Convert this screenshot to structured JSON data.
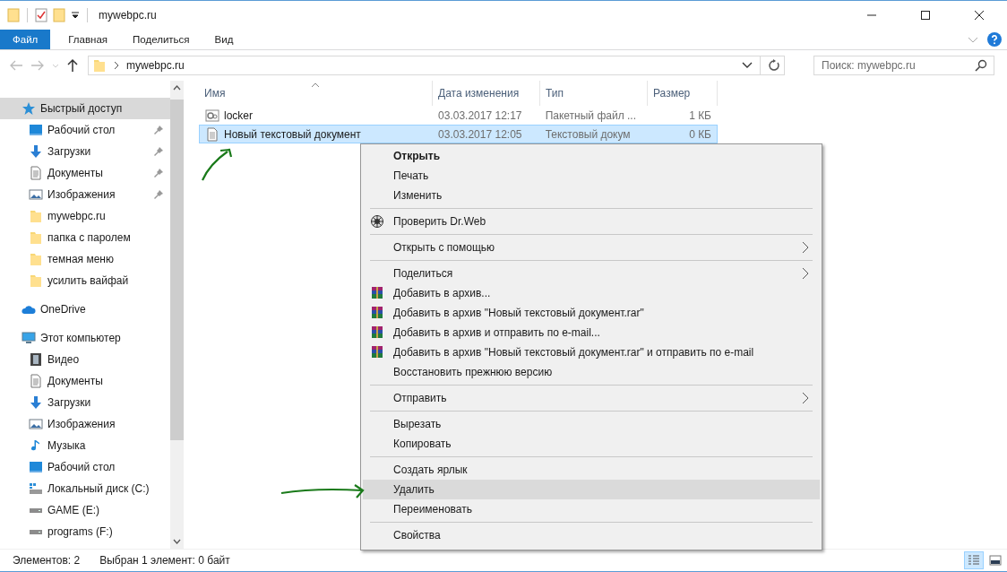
{
  "window": {
    "title": "mywebpc.ru"
  },
  "ribbon": {
    "tabs": [
      {
        "label": "Файл",
        "kind": "file"
      },
      {
        "label": "Главная",
        "kind": "tab"
      },
      {
        "label": "Поделиться",
        "kind": "tab"
      },
      {
        "label": "Вид",
        "kind": "tab"
      }
    ]
  },
  "address": {
    "path": "mywebpc.ru"
  },
  "search": {
    "placeholder": "Поиск: mywebpc.ru"
  },
  "sidebar": {
    "items": [
      {
        "label": "Быстрый доступ",
        "kind": "star",
        "selected": true,
        "children": [
          {
            "label": "Рабочий стол",
            "kind": "desktop",
            "pinned": true,
            "selected": false
          },
          {
            "label": "Загрузки",
            "kind": "download",
            "pinned": true,
            "selected": false
          },
          {
            "label": "Документы",
            "kind": "document",
            "pinned": true,
            "selected": false
          },
          {
            "label": "Изображения",
            "kind": "pictures",
            "pinned": true,
            "selected": false
          },
          {
            "label": "mywebpc.ru",
            "kind": "folder",
            "pinned": false,
            "selected": false
          },
          {
            "label": "папка с паролем",
            "kind": "folder",
            "pinned": false,
            "selected": false
          },
          {
            "label": "темная меню",
            "kind": "folder",
            "pinned": false,
            "selected": false
          },
          {
            "label": "усилить вайфай",
            "kind": "folder",
            "pinned": false,
            "selected": false
          }
        ]
      },
      {
        "label": "OneDrive",
        "kind": "cloud",
        "selected": false
      },
      {
        "label": "Этот компьютер",
        "kind": "computer",
        "selected": false,
        "children": [
          {
            "label": "Видео",
            "kind": "video",
            "pinned": false,
            "selected": false
          },
          {
            "label": "Документы",
            "kind": "document",
            "pinned": false,
            "selected": false
          },
          {
            "label": "Загрузки",
            "kind": "download",
            "pinned": false,
            "selected": false
          },
          {
            "label": "Изображения",
            "kind": "pictures",
            "pinned": false,
            "selected": false
          },
          {
            "label": "Музыка",
            "kind": "music",
            "pinned": false,
            "selected": false
          },
          {
            "label": "Рабочий стол",
            "kind": "desktop",
            "pinned": false,
            "selected": false
          },
          {
            "label": "Локальный диск (C:)",
            "kind": "drive_os",
            "pinned": false,
            "selected": false
          },
          {
            "label": "GAME (E:)",
            "kind": "drive",
            "pinned": false,
            "selected": false
          },
          {
            "label": "programs (F:)",
            "kind": "drive",
            "pinned": false,
            "selected": false
          }
        ]
      }
    ]
  },
  "table": {
    "columns": [
      "Имя",
      "Дата изменения",
      "Тип",
      "Размер"
    ],
    "rows": [
      {
        "name": "locker",
        "kind": "batch",
        "date": "03.03.2017 12:17",
        "type": "Пакетный файл ...",
        "size": "1 КБ",
        "selected": false
      },
      {
        "name": "Новый текстовый документ",
        "kind": "text",
        "date": "03.03.2017 12:05",
        "type": "Текстовый докум",
        "size": "0 КБ",
        "selected": true
      }
    ]
  },
  "context_menu": {
    "groups": [
      [
        {
          "label": "Открыть",
          "kind": "plain",
          "default": true,
          "submenu": false,
          "selected": false
        },
        {
          "label": "Печать",
          "kind": "plain",
          "default": false,
          "submenu": false,
          "selected": false
        },
        {
          "label": "Изменить",
          "kind": "plain",
          "default": false,
          "submenu": false,
          "selected": false
        }
      ],
      [
        {
          "label": "Проверить Dr.Web",
          "kind": "drweb",
          "default": false,
          "submenu": false,
          "selected": false
        }
      ],
      [
        {
          "label": "Открыть с помощью",
          "kind": "plain",
          "default": false,
          "submenu": true,
          "selected": false
        }
      ],
      [
        {
          "label": "Поделиться",
          "kind": "plain",
          "default": false,
          "submenu": true,
          "selected": false
        },
        {
          "label": "Добавить в архив...",
          "kind": "rar",
          "default": false,
          "submenu": false,
          "selected": false
        },
        {
          "label": "Добавить в архив \"Новый текстовый документ.rar\"",
          "kind": "rar",
          "default": false,
          "submenu": false,
          "selected": false
        },
        {
          "label": "Добавить в архив и отправить по e-mail...",
          "kind": "rar",
          "default": false,
          "submenu": false,
          "selected": false
        },
        {
          "label": "Добавить в архив \"Новый текстовый документ.rar\" и отправить по e-mail",
          "kind": "rar",
          "default": false,
          "submenu": false,
          "selected": false
        },
        {
          "label": "Восстановить прежнюю версию",
          "kind": "plain",
          "default": false,
          "submenu": false,
          "selected": false
        }
      ],
      [
        {
          "label": "Отправить",
          "kind": "plain",
          "default": false,
          "submenu": true,
          "selected": false
        }
      ],
      [
        {
          "label": "Вырезать",
          "kind": "plain",
          "default": false,
          "submenu": false,
          "selected": false
        },
        {
          "label": "Копировать",
          "kind": "plain",
          "default": false,
          "submenu": false,
          "selected": false
        }
      ],
      [
        {
          "label": "Создать ярлык",
          "kind": "plain",
          "default": false,
          "submenu": false,
          "selected": false
        },
        {
          "label": "Удалить",
          "kind": "plain",
          "default": false,
          "submenu": false,
          "selected": true
        },
        {
          "label": "Переименовать",
          "kind": "plain",
          "default": false,
          "submenu": false,
          "selected": false
        }
      ],
      [
        {
          "label": "Свойства",
          "kind": "plain",
          "default": false,
          "submenu": false,
          "selected": false
        }
      ]
    ]
  },
  "status_bar": {
    "count": "Элементов: 2",
    "selection": "Выбран 1 элемент: 0 байт",
    "views": [
      {
        "kind": "details",
        "selected": true
      },
      {
        "kind": "tiles",
        "selected": false
      }
    ]
  }
}
